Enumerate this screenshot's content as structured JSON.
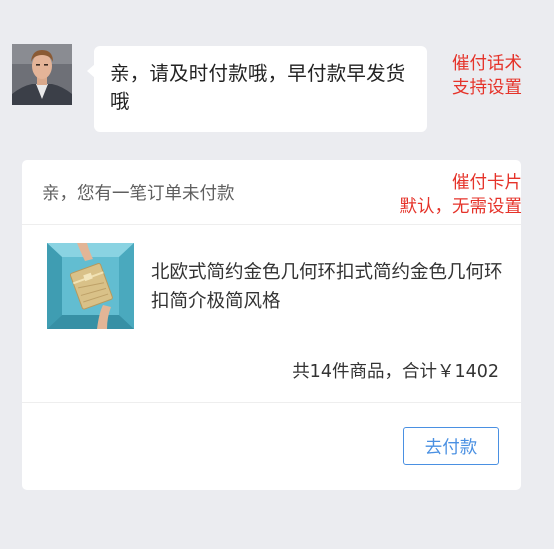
{
  "chat": {
    "message": "亲，请及时付款哦，早付款早发货哦"
  },
  "annotations": {
    "reminder_script_line1": "催付话术",
    "reminder_script_line2": "支持设置",
    "reminder_card_line1": "催付卡片",
    "reminder_card_line2": "默认，无需设置"
  },
  "order_card": {
    "header": "亲，您有一笔订单未付款",
    "product_title": "北欧式简约金色几何环扣式简约金色几何环扣简介极简风格",
    "summary": "共14件商品，合计￥1402",
    "pay_button_label": "去付款"
  },
  "colors": {
    "annotation_red": "#e5332a",
    "button_blue": "#4a90e2",
    "background": "#ebecf0"
  },
  "icons": {
    "avatar": "user-avatar-photo",
    "product_image": "product-thumbnail-photo"
  }
}
